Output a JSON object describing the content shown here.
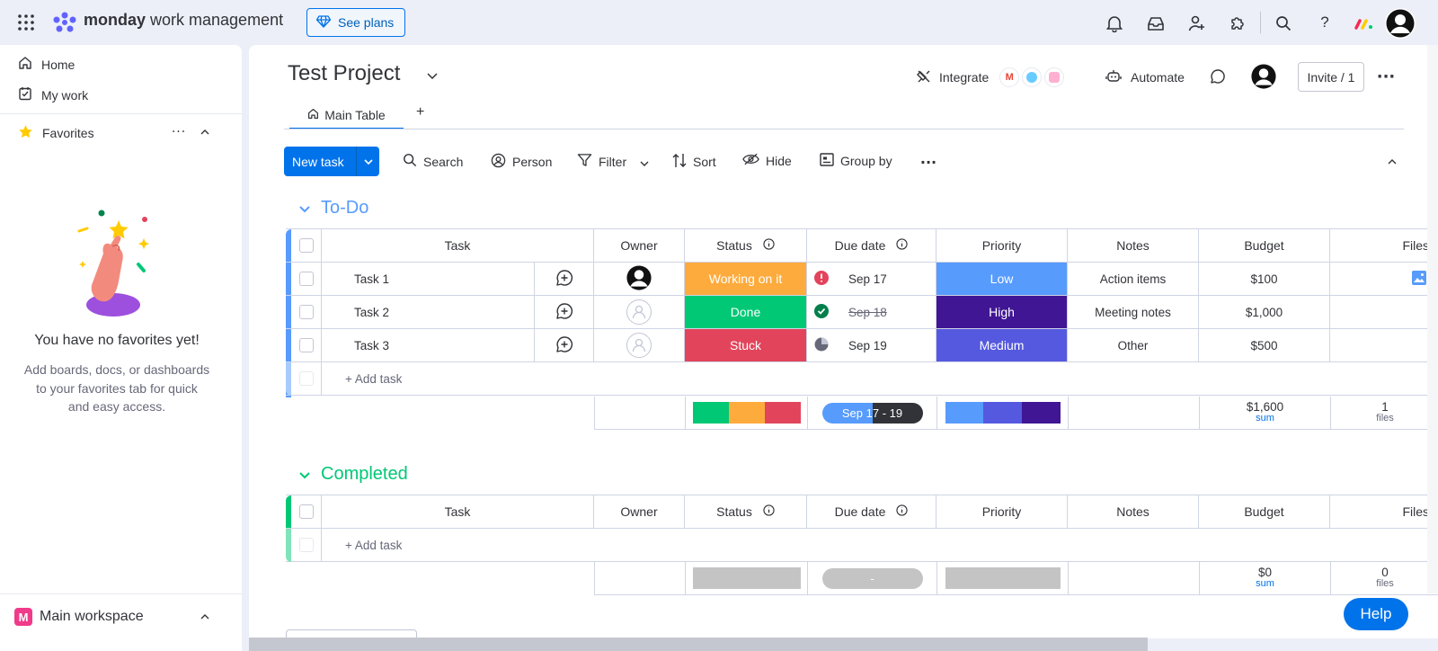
{
  "app": {
    "brand_bold": "monday",
    "brand_rest": " work management",
    "see_plans": "See plans"
  },
  "sidebar": {
    "home": "Home",
    "my_work": "My work",
    "favorites": "Favorites",
    "empty_title": "You have no favorites yet!",
    "empty_body_1": "Add boards, docs, or dashboards",
    "empty_body_2": "to your favorites tab for quick",
    "empty_body_3": "and easy access.",
    "workspace": "Main workspace",
    "workspace_badge": "M"
  },
  "board": {
    "title": "Test Project",
    "integrate": "Integrate",
    "automate": "Automate",
    "invite": "Invite / 1",
    "tab_main": "Main Table",
    "tab_add": "+"
  },
  "toolbar": {
    "new_task": "New task",
    "search": "Search",
    "person": "Person",
    "filter": "Filter",
    "sort": "Sort",
    "hide": "Hide",
    "group_by": "Group by"
  },
  "columns": {
    "task": "Task",
    "owner": "Owner",
    "status": "Status",
    "due": "Due date",
    "priority": "Priority",
    "notes": "Notes",
    "budget": "Budget",
    "files": "Files"
  },
  "groups": {
    "todo": {
      "title": "To-Do",
      "color": "#579bfc",
      "rows": [
        {
          "task": "Task 1",
          "status": "Working on it",
          "status_color": "#fdab3d",
          "due": "Sep 17",
          "priority": "Low",
          "priority_color": "#579bfc",
          "notes": "Action items",
          "budget": "$100"
        },
        {
          "task": "Task 2",
          "status": "Done",
          "status_color": "#00c875",
          "due": "Sep 18",
          "priority": "High",
          "priority_color": "#401694",
          "notes": "Meeting notes",
          "budget": "$1,000"
        },
        {
          "task": "Task 3",
          "status": "Stuck",
          "status_color": "#e2445c",
          "due": "Sep 19",
          "priority": "Medium",
          "priority_color": "#5559df",
          "notes": "Other",
          "budget": "$500"
        }
      ],
      "add_task": "+ Add task",
      "summary": {
        "date_range": "Sep 17 - 19",
        "budget": "$1,600",
        "budget_sub": "sum",
        "files": "1",
        "files_sub": "files"
      }
    },
    "completed": {
      "title": "Completed",
      "color": "#00c875",
      "add_task": "+ Add task",
      "summary": {
        "date_range": "-",
        "budget": "$0",
        "budget_sub": "sum",
        "files": "0",
        "files_sub": "files"
      }
    }
  },
  "help": "Help"
}
